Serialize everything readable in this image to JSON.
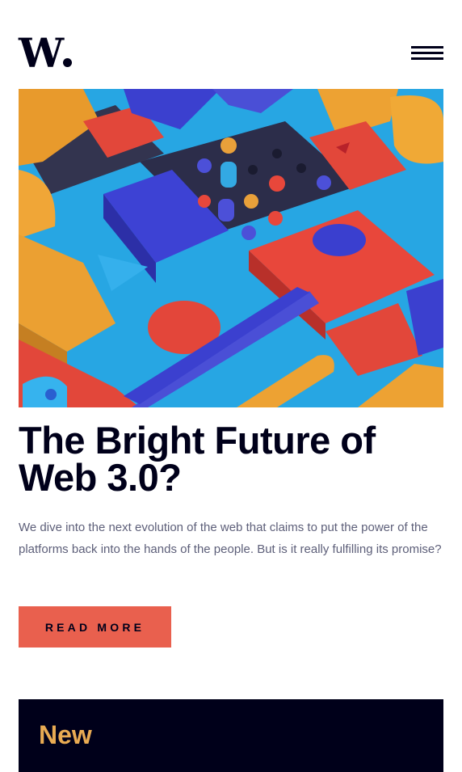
{
  "brand": {
    "logo_text": "W"
  },
  "header": {
    "menu_icon": "hamburger-menu-icon"
  },
  "hero": {
    "image_description_icon": "abstract-3d-blocks-illustration",
    "title": "The Bright Future of Web 3.0?",
    "excerpt": "We dive into the next evolution of the web that claims to put the power of the platforms back into the hands of the people. But is it really fulfilling its promise?",
    "cta_label": "READ MORE"
  },
  "new_section": {
    "title": "New"
  },
  "colors": {
    "navy": "#00001a",
    "accent_red": "#e9604e",
    "accent_orange": "#e9ab53",
    "text_gray": "#5d5f79"
  }
}
